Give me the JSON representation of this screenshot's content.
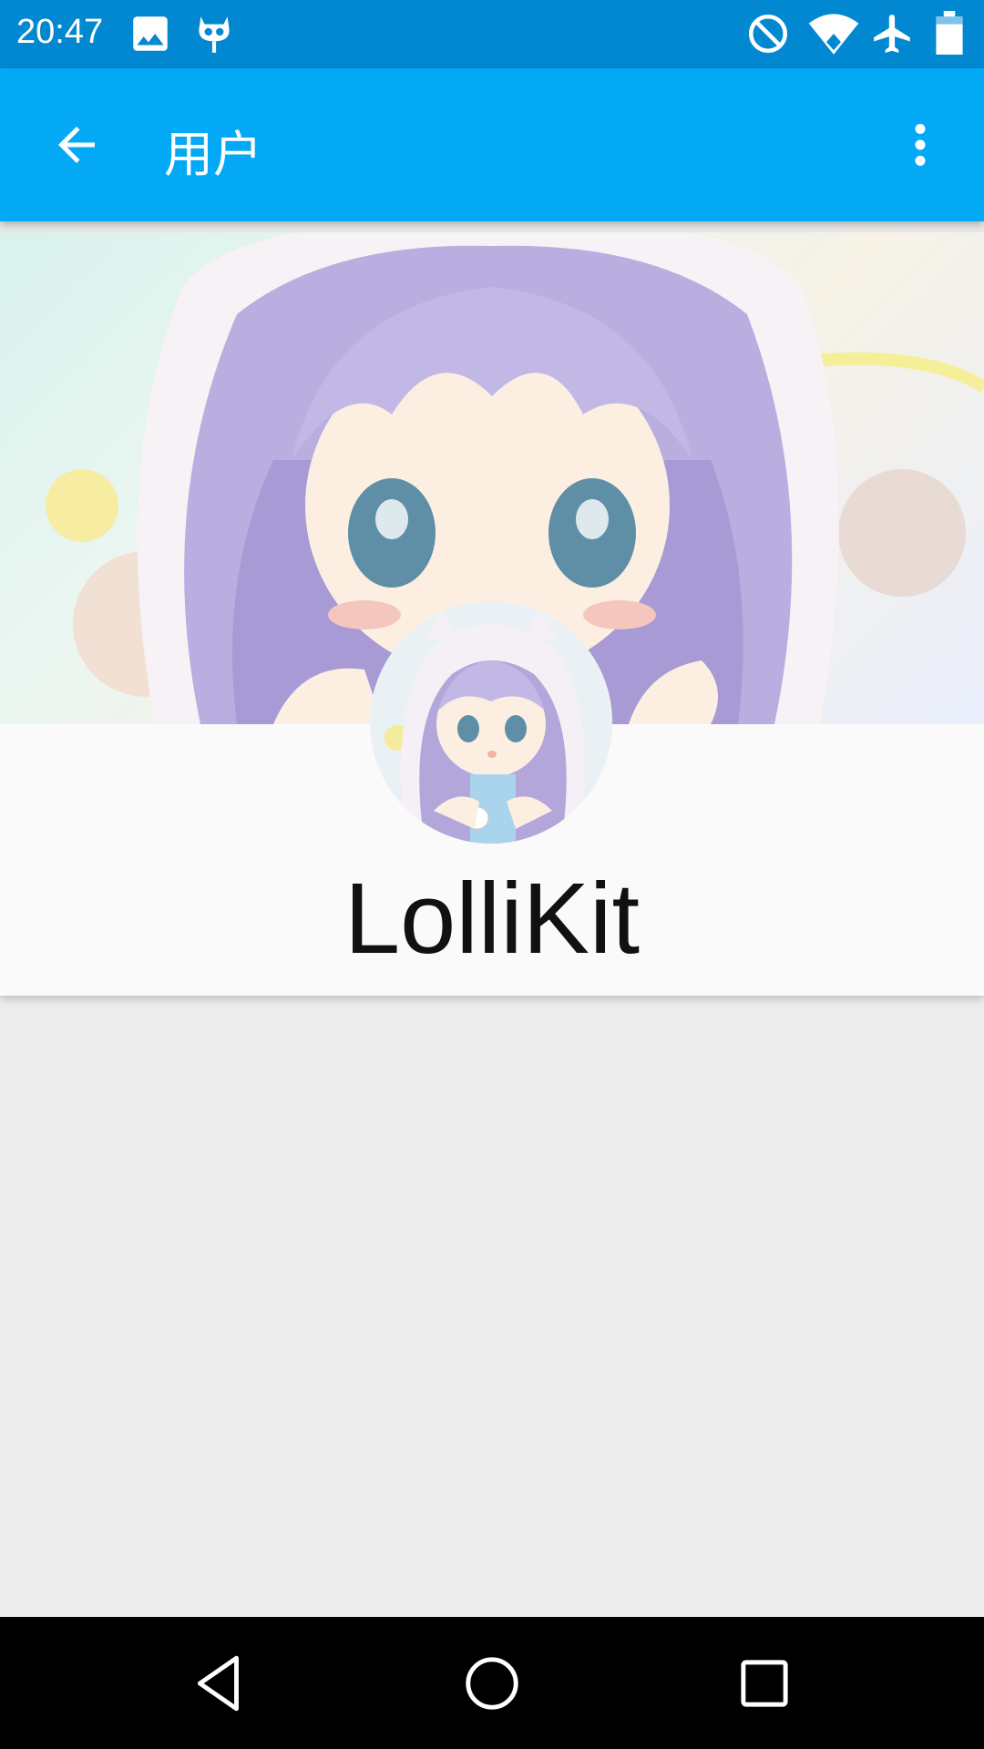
{
  "status_bar": {
    "time": "20:47",
    "left_icons": [
      "image-icon",
      "cyanogen-mascot-icon"
    ],
    "right_icons": [
      "do-not-disturb-icon",
      "wifi-icon",
      "airplane-mode-icon",
      "battery-icon"
    ]
  },
  "app_bar": {
    "title": "用户",
    "back_icon": "arrow-back-icon",
    "menu_icon": "more-vert-icon",
    "color": "#03a9f4"
  },
  "profile": {
    "username": "LolliKit"
  },
  "nav_bar": {
    "buttons": [
      "back-triangle-icon",
      "home-circle-icon",
      "recents-square-icon"
    ]
  },
  "colors": {
    "status_bar": "#0288d1",
    "app_bar": "#03a9f4",
    "background": "#ececec",
    "card": "#fafafa"
  }
}
